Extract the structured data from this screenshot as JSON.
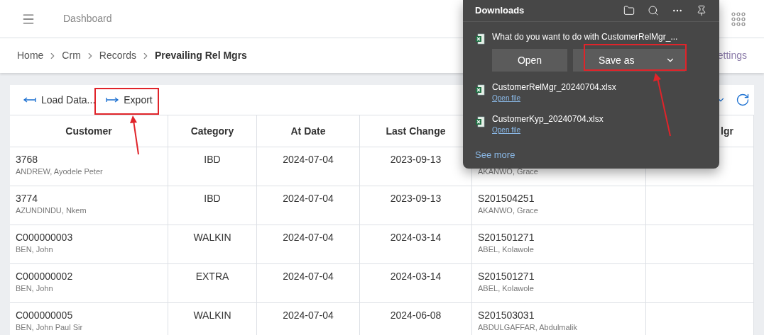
{
  "header": {
    "title": "Dashboard"
  },
  "breadcrumbs": [
    {
      "label": "Home",
      "current": false
    },
    {
      "label": "Crm",
      "current": false
    },
    {
      "label": "Records",
      "current": false
    },
    {
      "label": "Prevailing Rel Mgrs",
      "current": true
    }
  ],
  "settings_link": "ettings",
  "toolbar": [
    {
      "label": "Load Data...",
      "kind": "load"
    },
    {
      "label": "Export",
      "kind": "export"
    }
  ],
  "table": {
    "columns": [
      {
        "label": "Customer"
      },
      {
        "label": "Category"
      },
      {
        "label": "At Date"
      },
      {
        "label": "Last Change"
      },
      {},
      {
        "label": "lgr"
      }
    ],
    "rows": [
      {
        "id": "3768",
        "name": "ANDREW, Ayodele Peter",
        "category": "IBD",
        "at_date": "2024-07-04",
        "last_change": "2023-09-13",
        "rm_name": "AKANWO, Grace"
      },
      {
        "id": "3774",
        "name": "AZUNDINDU, Nkem",
        "category": "IBD",
        "at_date": "2024-07-04",
        "last_change": "2023-09-13",
        "rm_id": "S201504251",
        "rm_name": "AKANWO, Grace"
      },
      {
        "id": "C000000003",
        "name": "BEN, John",
        "category": "WALKIN",
        "at_date": "2024-07-04",
        "last_change": "2024-03-14",
        "rm_id": "S201501271",
        "rm_name": "ABEL, Kolawole"
      },
      {
        "id": "C000000002",
        "name": "BEN, John",
        "category": "EXTRA",
        "at_date": "2024-07-04",
        "last_change": "2024-03-14",
        "rm_id": "S201501271",
        "rm_name": "ABEL, Kolawole"
      },
      {
        "id": "C000000005",
        "name": "BEN, John Paul Sir",
        "category": "WALKIN",
        "at_date": "2024-07-04",
        "last_change": "2024-06-08",
        "rm_id": "S201503031",
        "rm_name": "ABDULGAFFAR, Abdulmalik"
      }
    ]
  },
  "downloads": {
    "title": "Downloads",
    "prompt": "What do you want to do with CustomerRelMgr_...",
    "actions": [
      {
        "label": "Open",
        "kind": "open"
      },
      {
        "label": "Save as",
        "kind": "save"
      }
    ],
    "files": [
      {
        "name": "CustomerRelMgr_20240704.xlsx",
        "link": "Open file"
      },
      {
        "name": "CustomerKyp_20240704.xlsx",
        "link": "Open file"
      }
    ],
    "see_more": "See more"
  }
}
